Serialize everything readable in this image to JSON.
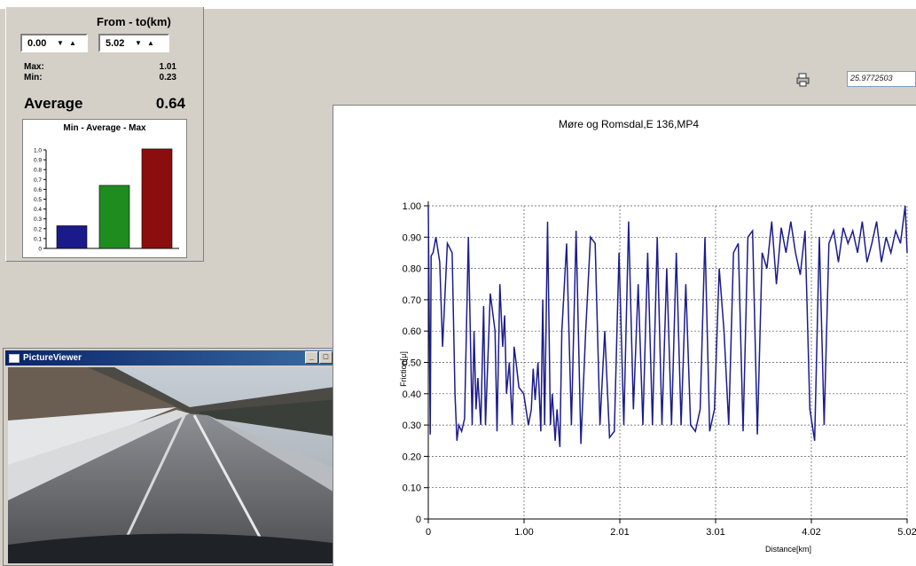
{
  "panel": {
    "range_label": "From - to(km)",
    "from_value": "0.00",
    "to_value": "5.02",
    "max_label": "Max:",
    "max_value": "1.01",
    "min_label": "Min:",
    "min_value": "0.23",
    "avg_label": "Average",
    "avg_value": "0.64"
  },
  "mini_chart": {
    "type": "bar",
    "title": "Min - Average - Max",
    "values": [
      0.23,
      0.64,
      1.01
    ],
    "colors": [
      "#1a1a8c",
      "#1e8c1e",
      "#8c0d0d"
    ],
    "yticks": [
      "1.0",
      "0.9",
      "0.8",
      "0.7",
      "0.6",
      "0.5",
      "0.4",
      "0.3",
      "0.2",
      "0.1",
      "0"
    ],
    "ylim": [
      0,
      1.0
    ]
  },
  "viewer": {
    "title": "PictureViewer",
    "minimize": "_",
    "maximize": "□",
    "close": "×"
  },
  "toolbar": {
    "value_field": "25.9772503",
    "icon": "printer-icon"
  },
  "chart_data": {
    "type": "line",
    "title": "Møre og Romsdal,E 136,MP4",
    "xlabel": "Distance[km]",
    "ylabel": "Friction[μ]",
    "xlim": [
      0,
      5.02
    ],
    "ylim": [
      0,
      1.0
    ],
    "xticks": [
      "0",
      "1.00",
      "2.01",
      "3.01",
      "4.02",
      "5.02"
    ],
    "yticks": [
      "0",
      "0.10",
      "0.20",
      "0.30",
      "0.40",
      "0.50",
      "0.60",
      "0.70",
      "0.80",
      "0.90",
      "1.00"
    ],
    "grid": true,
    "line_color": "#1c1c8c",
    "series": [
      {
        "x": [
          0,
          0.02,
          0.03,
          0.05,
          0.08,
          0.12,
          0.15,
          0.2,
          0.25,
          0.28,
          0.3,
          0.32,
          0.35,
          0.38,
          0.42,
          0.46,
          0.48,
          0.5,
          0.52,
          0.55,
          0.58,
          0.6,
          0.65,
          0.7,
          0.72,
          0.75,
          0.78,
          0.8,
          0.82,
          0.85,
          0.88,
          0.9,
          0.92,
          0.95,
          1.0,
          1.05,
          1.08,
          1.1,
          1.12,
          1.15,
          1.18,
          1.2,
          1.22,
          1.25,
          1.28,
          1.3,
          1.33,
          1.35,
          1.38,
          1.4,
          1.45,
          1.5,
          1.55,
          1.6,
          1.65,
          1.7,
          1.75,
          1.8,
          1.85,
          1.9,
          1.95,
          2.0,
          2.05,
          2.1,
          2.15,
          2.2,
          2.25,
          2.3,
          2.35,
          2.4,
          2.45,
          2.5,
          2.55,
          2.6,
          2.65,
          2.7,
          2.75,
          2.8,
          2.85,
          2.9,
          2.95,
          3.0,
          3.05,
          3.1,
          3.15,
          3.2,
          3.25,
          3.3,
          3.35,
          3.4,
          3.45,
          3.5,
          3.55,
          3.6,
          3.65,
          3.7,
          3.75,
          3.8,
          3.85,
          3.9,
          3.95,
          4.0,
          4.05,
          4.1,
          4.15,
          4.2,
          4.25,
          4.3,
          4.35,
          4.4,
          4.45,
          4.5,
          4.55,
          4.6,
          4.65,
          4.7,
          4.75,
          4.8,
          4.85,
          4.9,
          4.95,
          5.0,
          5.02
        ],
        "y": [
          1.0,
          0.27,
          0.84,
          0.85,
          0.9,
          0.82,
          0.55,
          0.88,
          0.85,
          0.4,
          0.25,
          0.3,
          0.28,
          0.32,
          0.9,
          0.3,
          0.6,
          0.35,
          0.45,
          0.3,
          0.68,
          0.3,
          0.72,
          0.6,
          0.28,
          0.75,
          0.55,
          0.65,
          0.4,
          0.5,
          0.3,
          0.55,
          0.5,
          0.42,
          0.4,
          0.3,
          0.35,
          0.48,
          0.38,
          0.5,
          0.28,
          0.7,
          0.3,
          0.95,
          0.3,
          0.4,
          0.25,
          0.35,
          0.23,
          0.6,
          0.88,
          0.3,
          0.92,
          0.24,
          0.6,
          0.9,
          0.88,
          0.3,
          0.6,
          0.26,
          0.28,
          0.85,
          0.3,
          0.95,
          0.35,
          0.75,
          0.3,
          0.85,
          0.3,
          0.9,
          0.3,
          0.8,
          0.3,
          0.85,
          0.3,
          0.75,
          0.3,
          0.28,
          0.35,
          0.9,
          0.28,
          0.35,
          0.8,
          0.6,
          0.3,
          0.85,
          0.88,
          0.28,
          0.9,
          0.92,
          0.27,
          0.85,
          0.8,
          0.95,
          0.75,
          0.93,
          0.85,
          0.95,
          0.85,
          0.78,
          0.92,
          0.35,
          0.25,
          0.9,
          0.3,
          0.88,
          0.92,
          0.82,
          0.93,
          0.88,
          0.92,
          0.85,
          0.95,
          0.82,
          0.88,
          0.95,
          0.82,
          0.9,
          0.85,
          0.92,
          0.88,
          1.0,
          0.85
        ]
      }
    ]
  }
}
